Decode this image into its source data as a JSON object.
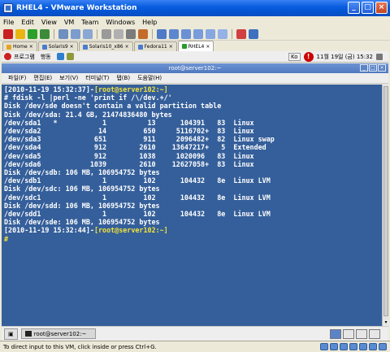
{
  "window": {
    "title": "RHEL4 - VMware Workstation"
  },
  "menu": [
    "File",
    "Edit",
    "View",
    "VM",
    "Team",
    "Windows",
    "Help"
  ],
  "tabs": [
    {
      "label": "Home",
      "active": false
    },
    {
      "label": "Solaris9",
      "active": false
    },
    {
      "label": "Solaris10_x86",
      "active": false
    },
    {
      "label": "Fedora11",
      "active": false
    },
    {
      "label": "RHEL4",
      "active": true
    }
  ],
  "guest_panel": {
    "items": [
      "프로그램",
      "행동"
    ],
    "input_method": "Ko",
    "clock": "11월 19일 (금) 15:32"
  },
  "terminal": {
    "title": "root@server102:~",
    "menu": [
      "파일(F)",
      "편집(E)",
      "보기(V)",
      "터미널(T)",
      "탭(B)",
      "도움말(H)"
    ],
    "lines": [
      {
        "text": "[2010-11-19 15:32:37]-",
        "prompt": "[root@server102:~]"
      },
      {
        "text": "# fdisk -l |perl -ne 'print if /\\/dev.+/'"
      },
      {
        "text": "Disk /dev/sde doesn't contain a valid partition table"
      },
      {
        "text": "Disk /dev/sda: 21.4 GB, 21474836480 bytes"
      },
      {
        "text": "/dev/sda1   *           1          13      104391   83  Linux"
      },
      {
        "text": "/dev/sda2              14         650     5116702+  83  Linux"
      },
      {
        "text": "/dev/sda3             651         911     2096482+  82  Linux swap"
      },
      {
        "text": "/dev/sda4             912        2610    13647217+   5  Extended"
      },
      {
        "text": "/dev/sda5             912        1038     1020096   83  Linux"
      },
      {
        "text": "/dev/sda6            1039        2610    12627058+  83  Linux"
      },
      {
        "text": "Disk /dev/sdb: 106 MB, 106954752 bytes"
      },
      {
        "text": "/dev/sdb1               1         102      104432   8e  Linux LVM"
      },
      {
        "text": "Disk /dev/sdc: 106 MB, 106954752 bytes"
      },
      {
        "text": "/dev/sdc1               1         102      104432   8e  Linux LVM"
      },
      {
        "text": "Disk /dev/sdd: 106 MB, 106954752 bytes"
      },
      {
        "text": "/dev/sdd1               1         102      104432   8e  Linux LVM"
      },
      {
        "text": "Disk /dev/sde: 106 MB, 106954752 bytes"
      },
      {
        "text": "[2010-11-19 15:32:44]-",
        "prompt": "[root@server102:~]"
      },
      {
        "text": "#",
        "cursor": true
      }
    ]
  },
  "taskbar": {
    "task_label": "root@server102:~"
  },
  "status_bar": {
    "text": "To direct input to this VM, click inside or press Ctrl+G."
  },
  "colors": {
    "terminal_bg": "#355f9a",
    "prompt": "#f2e23a",
    "titlebar": "#0454d3"
  }
}
